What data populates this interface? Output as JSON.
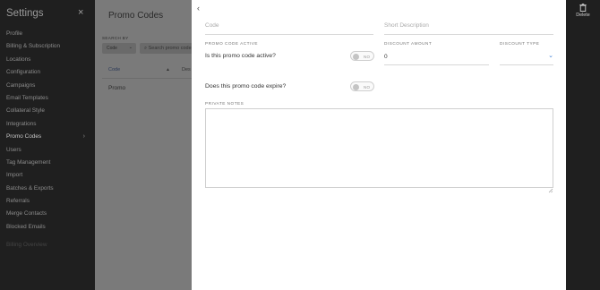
{
  "settings": {
    "title": "Settings",
    "close_icon": "×",
    "nav": [
      {
        "label": "Profile"
      },
      {
        "label": "Billing & Subscription"
      },
      {
        "label": "Locations"
      },
      {
        "label": "Configuration"
      },
      {
        "label": "Campaigns"
      },
      {
        "label": "Email Templates"
      },
      {
        "label": "Collateral Style"
      },
      {
        "label": "Integrations"
      },
      {
        "label": "Promo Codes",
        "active": true,
        "chevron": "›"
      },
      {
        "label": "Users"
      },
      {
        "label": "Tag Management"
      },
      {
        "label": "Import"
      },
      {
        "label": "Batches & Exports"
      },
      {
        "label": "Referrals"
      },
      {
        "label": "Merge Contacts"
      },
      {
        "label": "Blocked Emails"
      },
      {
        "label": "Billing Overview"
      }
    ]
  },
  "promo_page": {
    "title": "Promo Codes",
    "search_by_label": "SEARCH BY",
    "search_select_value": "Code",
    "search_placeholder": "Search promo code",
    "columns": {
      "code": "Code",
      "sort_arrow": "▲",
      "description": "Des"
    },
    "rows": [
      {
        "code": "Promo"
      }
    ]
  },
  "detail": {
    "back_icon": "‹",
    "code_placeholder": "Code",
    "short_description_placeholder": "Short Description",
    "promo_active_label": "PROMO CODE ACTIVE",
    "promo_active_question": "Is this promo code active?",
    "active_toggle": {
      "value": false,
      "label": "NO"
    },
    "discount_amount_label": "DISCOUNT AMOUNT",
    "discount_amount_value": "0",
    "discount_type_label": "DISCOUNT TYPE",
    "discount_type_value": "",
    "expire_question": "Does this promo code expire?",
    "expire_toggle": {
      "value": false,
      "label": "NO"
    },
    "private_notes_label": "PRIVATE NOTES",
    "private_notes_value": ""
  },
  "actions": {
    "delete_label": "Delete",
    "delete_icon": "trash-icon"
  },
  "colors": {
    "accent": "#3a7bd5",
    "sidebar_bg": "#1f1f1f",
    "panel_bg": "#ffffff"
  }
}
